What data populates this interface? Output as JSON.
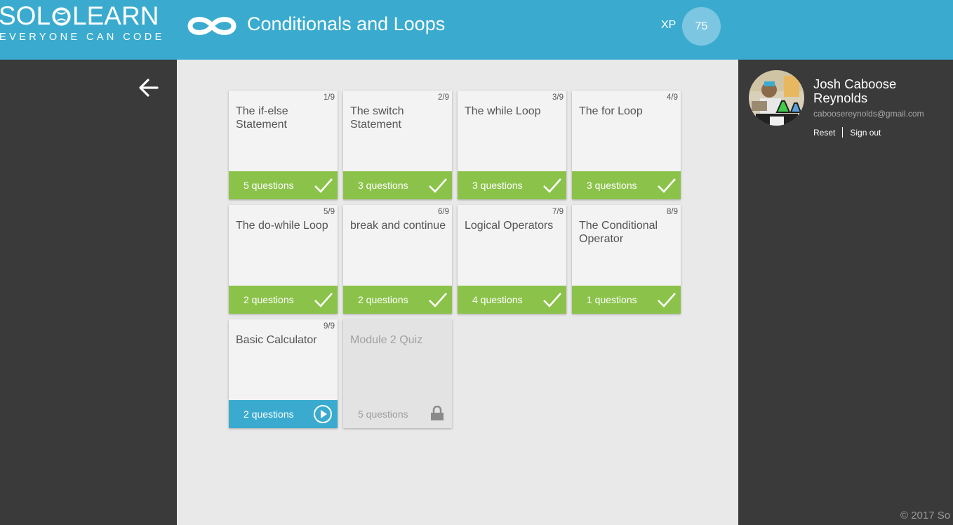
{
  "header": {
    "logo": {
      "left": "SOL",
      "right": "LEARN",
      "tagline": "EVERYONE CAN CODE"
    },
    "course_title": "Conditionals and Loops",
    "xp_label": "XP",
    "xp_value": "75"
  },
  "user": {
    "name": "Josh Caboose Reynolds",
    "email": "caboosereynolds@gmail.com",
    "reset_label": "Reset",
    "signout_label": "Sign out"
  },
  "footer": {
    "copyright": "© 2017 So"
  },
  "lessons": [
    {
      "index": "1/9",
      "title": "The if-else Statement",
      "questions": "5 questions",
      "status": "completed"
    },
    {
      "index": "2/9",
      "title": "The switch Statement",
      "questions": "3 questions",
      "status": "completed"
    },
    {
      "index": "3/9",
      "title": "The while Loop",
      "questions": "3 questions",
      "status": "completed"
    },
    {
      "index": "4/9",
      "title": "The for Loop",
      "questions": "3 questions",
      "status": "completed"
    },
    {
      "index": "5/9",
      "title": "The do-while Loop",
      "questions": "2 questions",
      "status": "completed"
    },
    {
      "index": "6/9",
      "title": "break and continue",
      "questions": "2 questions",
      "status": "completed"
    },
    {
      "index": "7/9",
      "title": "Logical Operators",
      "questions": "4 questions",
      "status": "completed"
    },
    {
      "index": "8/9",
      "title": "The Conditional Operator",
      "questions": "1 questions",
      "status": "completed"
    },
    {
      "index": "9/9",
      "title": "Basic Calculator",
      "questions": "2 questions",
      "status": "current"
    },
    {
      "index": "",
      "title": "Module 2 Quiz",
      "questions": "5 questions",
      "status": "locked"
    }
  ],
  "colors": {
    "header": "#3aabcf",
    "completed": "#8bc34a",
    "current": "#3aabcf",
    "locked": "#e3e3e3",
    "sidebar": "#3a3a3a",
    "main_bg": "#e9e9e9"
  },
  "icons": {
    "back": "arrow-left-icon",
    "course": "infinity-icon",
    "completed": "checkmark-icon",
    "current": "play-icon",
    "locked": "lock-icon"
  }
}
